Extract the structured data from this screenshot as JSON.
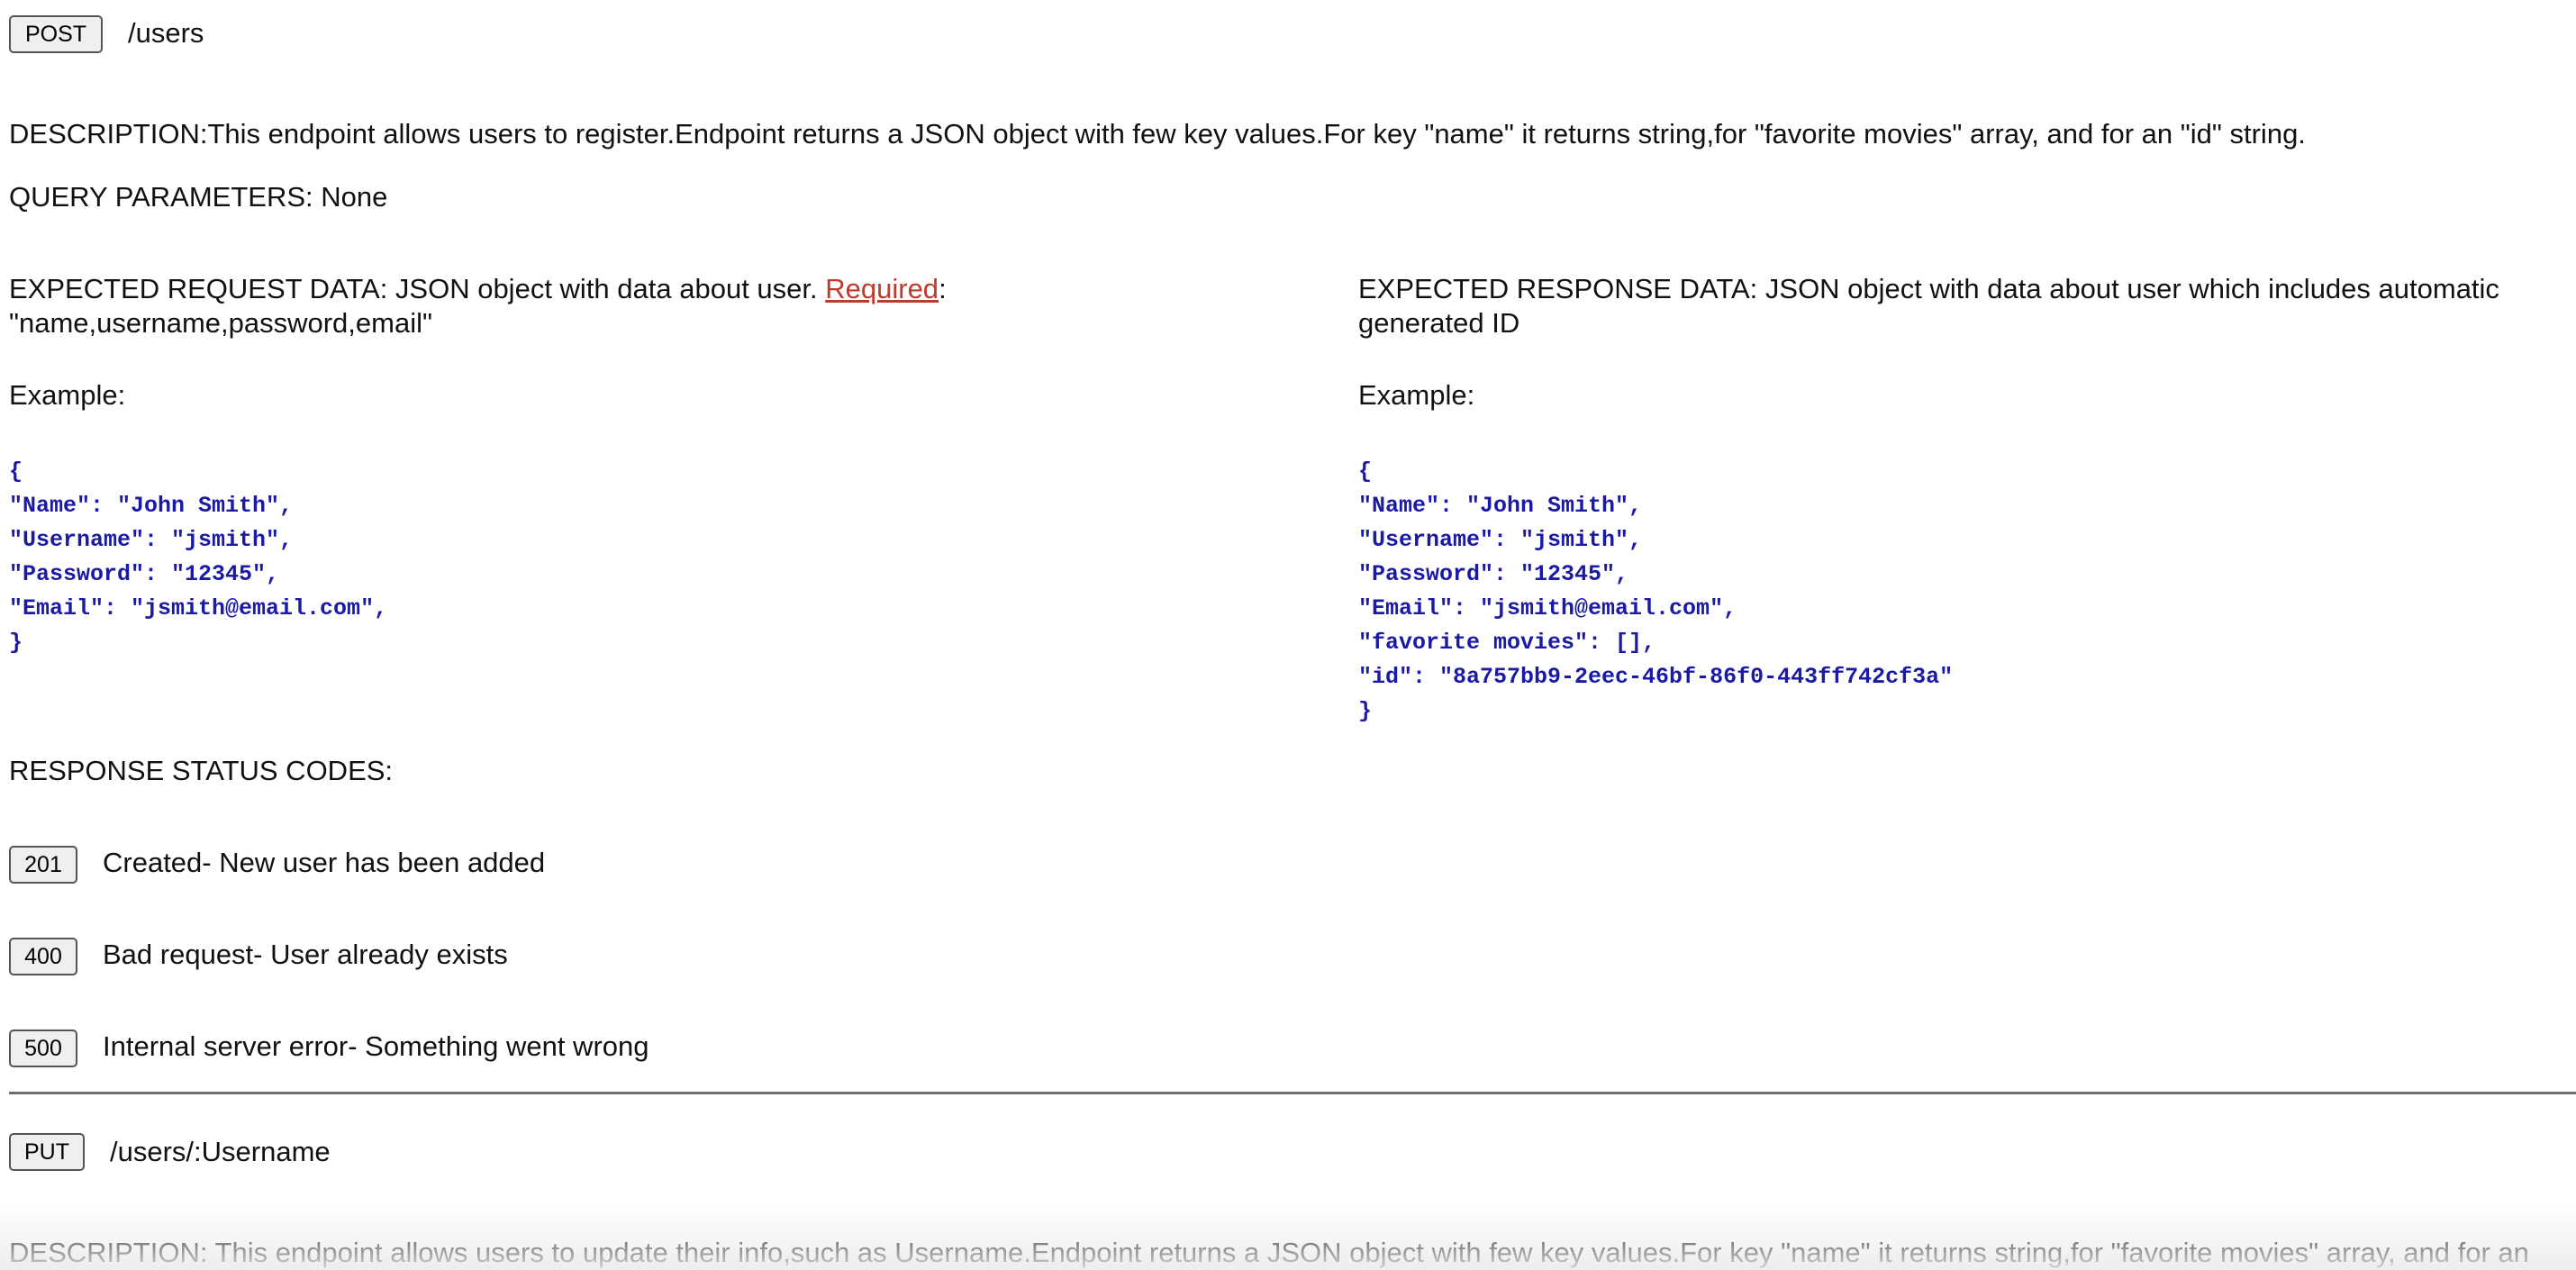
{
  "post_endpoint": {
    "method": "POST",
    "path": "/users",
    "description": "DESCRIPTION:This endpoint allows users to register.Endpoint returns a JSON object with few key values.For key \"name\" it returns string,for \"favorite movies\" array, and for an \"id\" string.",
    "query_parameters": "QUERY PARAMETERS: None",
    "request": {
      "text": "EXPECTED REQUEST DATA: JSON object with data about user. ",
      "required_link": "Required",
      "required_suffix": ":",
      "fields": "\"name,username,password,email\"",
      "example_label": "Example:",
      "example_code": "{\n\"Name\": \"John Smith\",\n\"Username\": \"jsmith\",\n\"Password\": \"12345\",\n\"Email\": \"jsmith@email.com\",\n}"
    },
    "response": {
      "text": "EXPECTED RESPONSE DATA: JSON object with data about user which includes automatic generated ID",
      "example_label": "Example:",
      "example_code": "{\n\"Name\": \"John Smith\",\n\"Username\": \"jsmith\",\n\"Password\": \"12345\",\n\"Email\": \"jsmith@email.com\",\n\"favorite movies\": [],\n\"id\": \"8a757bb9-2eec-46bf-86f0-443ff742cf3a\"\n}"
    },
    "status_heading": "RESPONSE STATUS CODES:",
    "status_codes": [
      {
        "code": "201",
        "text": "Created- New user has been added"
      },
      {
        "code": "400",
        "text": "Bad request- User already exists"
      },
      {
        "code": "500",
        "text": "Internal server error- Something went wrong"
      }
    ]
  },
  "put_endpoint": {
    "method": "PUT",
    "path": "/users/:Username",
    "description": "DESCRIPTION: This endpoint allows users to update their info,such as Username.Endpoint returns a JSON object with few key values.For key \"name\" it returns string,for \"favorite movies\" array, and for an"
  }
}
